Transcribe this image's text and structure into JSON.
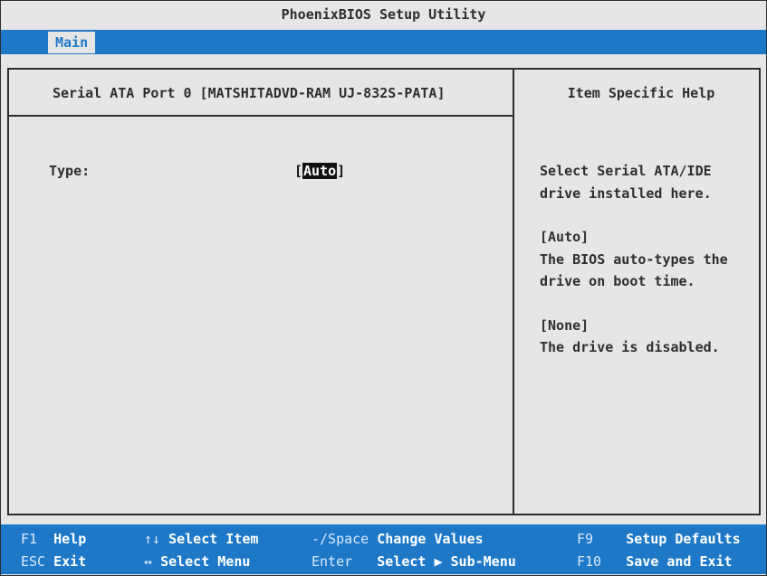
{
  "title": "PhoenixBIOS Setup Utility",
  "menu": {
    "tabs": [
      {
        "label": "Main"
      }
    ]
  },
  "main": {
    "header": "Serial ATA Port 0 [MATSHITADVD-RAM UJ-832S-PATA]",
    "field": {
      "label": "Type:",
      "value": "Auto",
      "bracket_open": "[",
      "bracket_close": "]"
    }
  },
  "help": {
    "header": "Item Specific Help",
    "lines": [
      "Select Serial ATA/IDE",
      "drive installed here.",
      "",
      "[Auto]",
      "The BIOS auto-types the",
      "drive on boot time.",
      "",
      "[None]",
      "The drive is disabled."
    ]
  },
  "footer": {
    "row1": [
      {
        "key": "F1",
        "label": "Help"
      },
      {
        "key": "↑↓",
        "label": "Select Item"
      },
      {
        "key": "-/Space",
        "label": "Change Values"
      },
      {
        "key": "F9",
        "label": "Setup Defaults"
      }
    ],
    "row2": [
      {
        "key": "ESC",
        "label": "Exit"
      },
      {
        "key": "↔",
        "label": "Select Menu"
      },
      {
        "key": "Enter",
        "label": "Select ▶ Sub-Menu"
      },
      {
        "key": "F10",
        "label": "Save and Exit"
      }
    ]
  },
  "colors": {
    "background": "#e6e6e6",
    "accent_blue": "#1e78c8",
    "text": "#2e2e2e"
  }
}
